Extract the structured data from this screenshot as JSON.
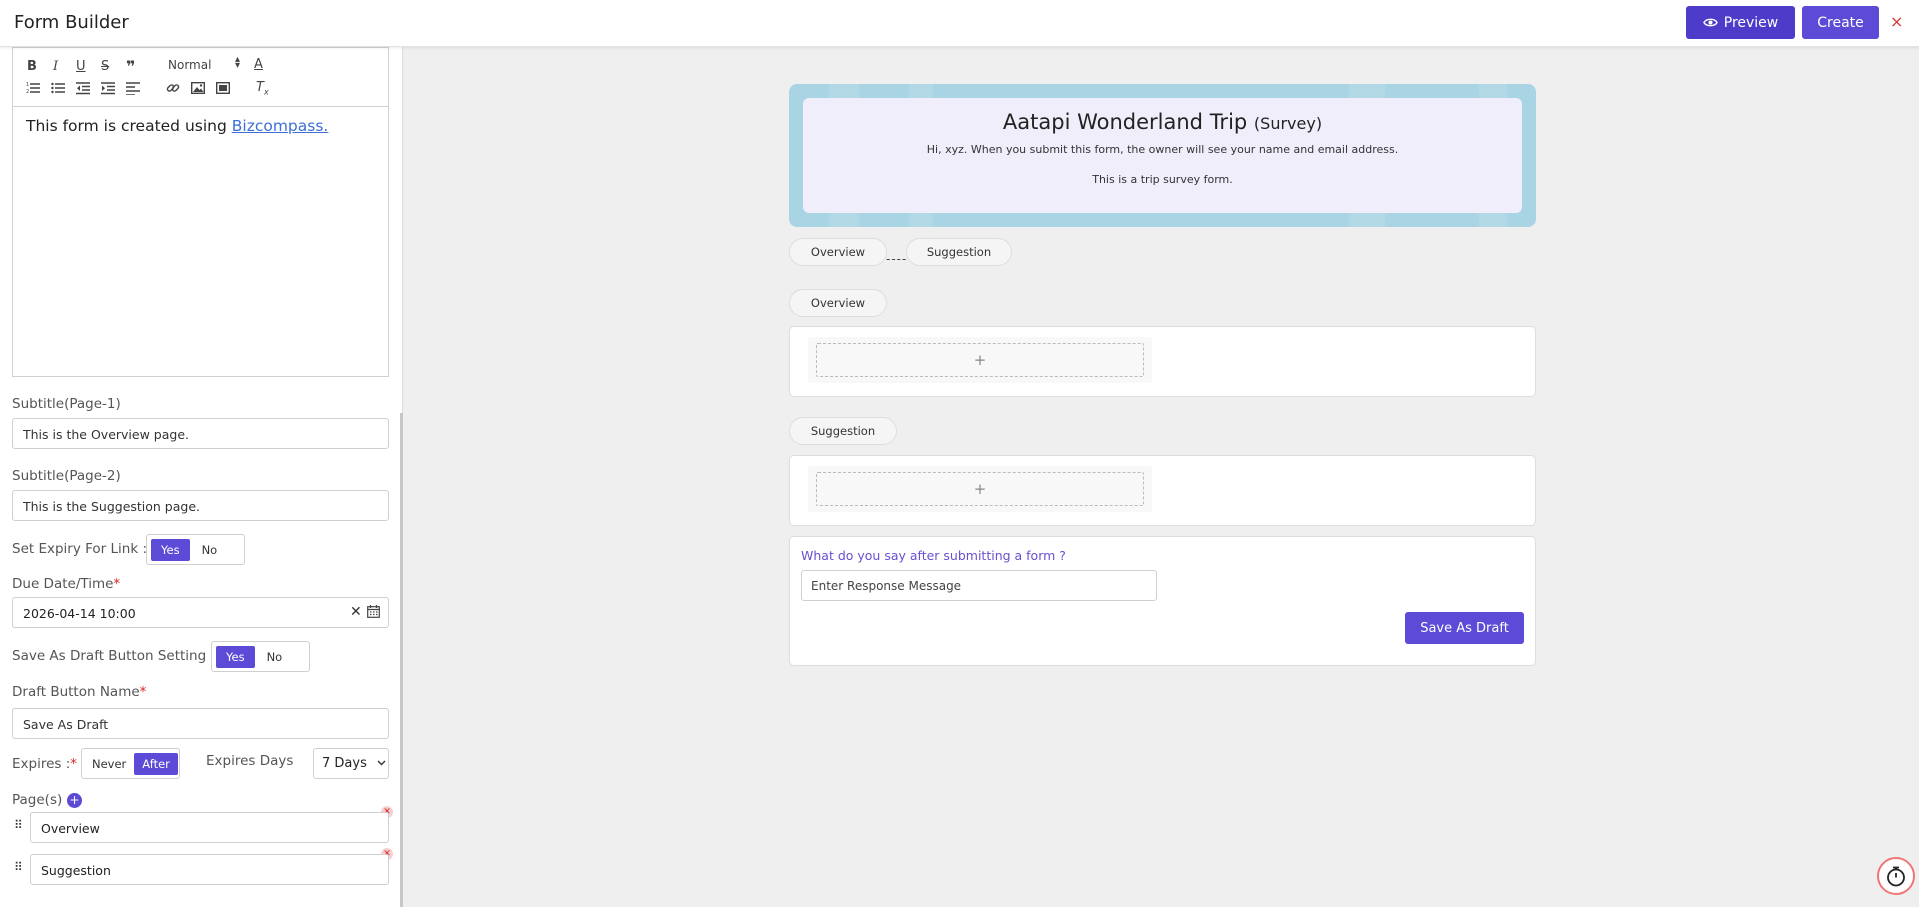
{
  "header": {
    "title": "Form Builder",
    "preview_label": "Preview",
    "create_label": "Create",
    "close_symbol": "×"
  },
  "editor": {
    "toolbar": {
      "heading_select": "Normal"
    },
    "content_prefix": "This form is created using ",
    "content_link": "Bizcompass."
  },
  "settings": {
    "subtitle_page1_label": "Subtitle(Page-1)",
    "subtitle_page1_value": "This is the Overview page.",
    "subtitle_page2_label": "Subtitle(Page-2)",
    "subtitle_page2_value": "This is the Suggestion page.",
    "expiry_label": "Set Expiry For Link :",
    "expiry_yes": "Yes",
    "expiry_no": "No",
    "due_label": "Due Date/Time",
    "due_value": "2026-04-14 10:00",
    "draft_setting_label": "Save As Draft Button Setting :",
    "draft_yes": "Yes",
    "draft_no": "No",
    "draft_name_label": "Draft Button Name",
    "draft_name_value": "Save As Draft",
    "expires_label": "Expires :",
    "expires_never": "Never",
    "expires_after": "After",
    "expires_days_label": "Expires Days",
    "expires_days_value": "7 Days",
    "pages_label": "Page(s)",
    "pages": [
      "Overview",
      "Suggestion"
    ]
  },
  "form": {
    "title": "Aatapi Wonderland Trip",
    "title_suffix": "(Survey)",
    "intro": "Hi, xyz. When you submit this form, the owner will see your name and email address.",
    "description": "This is a trip survey form.",
    "step_tabs": [
      "Overview",
      "Suggestion"
    ],
    "sections": [
      "Overview",
      "Suggestion"
    ],
    "add_symbol": "+",
    "response_question": "What do you say after submitting a form ?",
    "response_placeholder": "Enter Response Message",
    "draft_button": "Save As Draft"
  },
  "colors": {
    "primary": "#5b4bd6",
    "banner": "#a9d4e4",
    "banner_inner": "#f1eefb",
    "link": "#3d6fd6",
    "danger": "#d22222"
  }
}
